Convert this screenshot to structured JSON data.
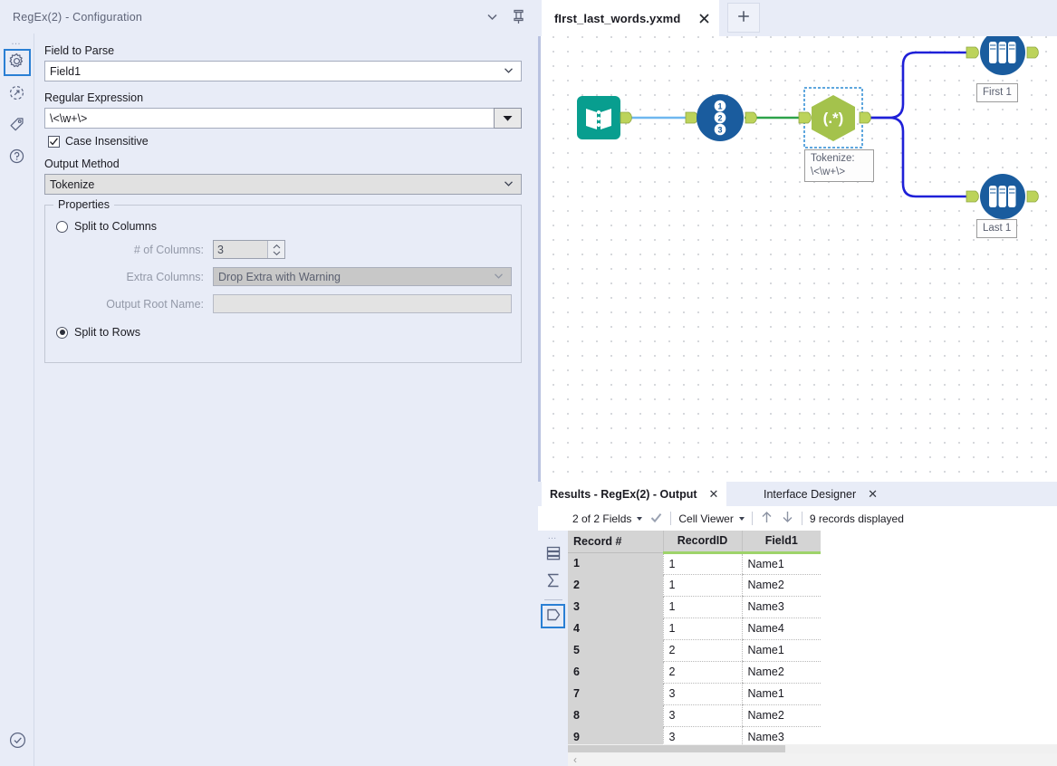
{
  "config": {
    "title": "RegEx(2) - Configuration",
    "header_icons": [
      "chevron-down-icon",
      "pin-icon"
    ],
    "rail_icons": [
      "gear-icon",
      "runtime-icon",
      "annotation-tag-icon",
      "help-icon"
    ],
    "rail_bottom_icon": "check-circle-icon",
    "field_to_parse": {
      "label": "Field to Parse",
      "value": "Field1"
    },
    "regular_expression": {
      "label": "Regular Expression",
      "value": "\\<\\w+\\>"
    },
    "case_insensitive": {
      "label": "Case Insensitive",
      "checked": true
    },
    "output_method": {
      "label": "Output Method",
      "value": "Tokenize"
    },
    "properties": {
      "legend": "Properties",
      "split_to_columns": {
        "label": "Split to Columns",
        "selected": false
      },
      "num_columns": {
        "label": "# of Columns:",
        "value": "3"
      },
      "extra_columns": {
        "label": "Extra Columns:",
        "value": "Drop Extra with Warning"
      },
      "output_root_name": {
        "label": "Output Root Name:",
        "value": ""
      },
      "split_to_rows": {
        "label": "Split to Rows",
        "selected": true
      }
    }
  },
  "workflow": {
    "tab": {
      "title": "fIrst_last_words.yxmd",
      "close": "✕"
    },
    "add_tab": "+",
    "nodes": [
      {
        "name": "input-data-tool",
        "label": ""
      },
      {
        "name": "record-id-tool",
        "label": ""
      },
      {
        "name": "regex-tool",
        "label": "Tokenize:\n\\<\\w+\\>",
        "selected": true
      },
      {
        "name": "browse-tool-first",
        "label": "First 1"
      },
      {
        "name": "browse-tool-last",
        "label": "Last 1"
      }
    ]
  },
  "results": {
    "tabs": [
      {
        "label": "Results - RegEx(2) - Output",
        "selected": true,
        "close": "✕"
      },
      {
        "label": "Interface Designer",
        "selected": false,
        "close": "✕"
      }
    ],
    "toolbar": {
      "fields": "2 of 2 Fields",
      "cell_viewer": "Cell Viewer",
      "up_arrow": "↑",
      "down_arrow": "↓",
      "records": "9 records displayed"
    },
    "rail_icons": [
      "data-grid-icon",
      "profile-sigma-icon",
      "metadata-icon"
    ],
    "table": {
      "columns": [
        "Record #",
        "RecordID",
        "Field1"
      ],
      "rows": [
        [
          "1",
          "1",
          "Name1"
        ],
        [
          "2",
          "1",
          "Name2"
        ],
        [
          "3",
          "1",
          "Name3"
        ],
        [
          "4",
          "1",
          "Name4"
        ],
        [
          "5",
          "2",
          "Name1"
        ],
        [
          "6",
          "2",
          "Name2"
        ],
        [
          "7",
          "3",
          "Name1"
        ],
        [
          "8",
          "3",
          "Name2"
        ],
        [
          "9",
          "3",
          "Name3"
        ]
      ]
    },
    "scroll_left_arrow": "‹"
  },
  "colors": {
    "panel_bg": "#e8ecf7",
    "accent_blue": "#2a7fd4",
    "connection_blue": "#1f20d8",
    "node_green": "#a4c24c",
    "node_teal": "#089e8f",
    "node_navy": "#1a5c9e",
    "header_green": "#9ed36a"
  }
}
